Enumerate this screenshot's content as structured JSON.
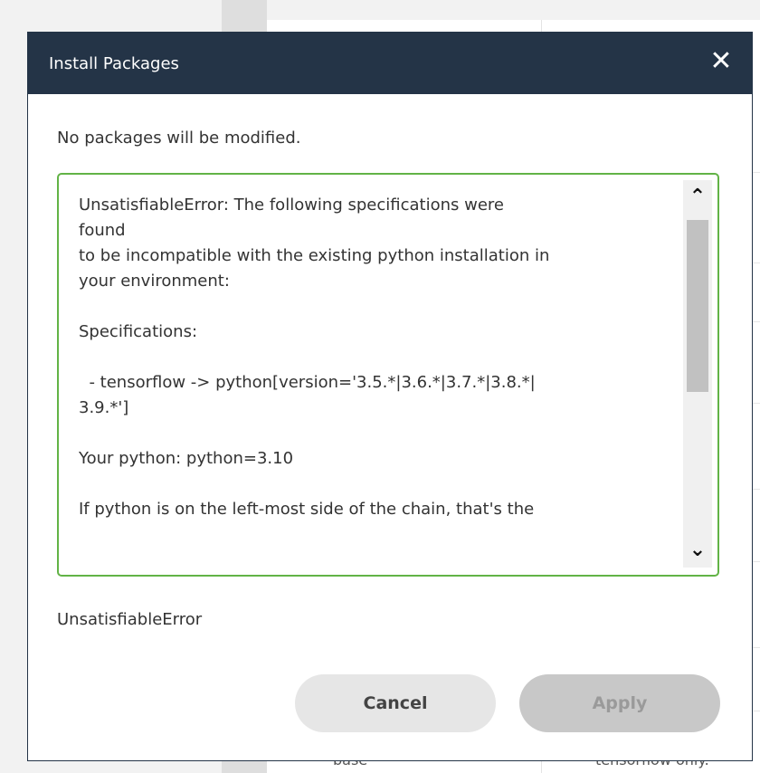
{
  "dialog": {
    "title": "Install Packages",
    "close_icon": "close-icon",
    "close_glyph": "✕",
    "summary": "No packages will be modified.",
    "error_lines": [
      "UnsatisfiableError: The following specifications were",
      "found",
      "to be incompatible with the existing python installation in",
      "your environment:",
      "",
      "Specifications:",
      "",
      "  - tensorflow -> python[version='3.5.*|3.6.*|3.7.*|3.8.*|",
      "3.9.*']",
      "",
      "Your python: python=3.10",
      "",
      "If python is on the left-most side of the chain, that's the"
    ],
    "error_label": "UnsatisfiableError",
    "cancel_label": "Cancel",
    "apply_label": "Apply",
    "scroll_up_glyph": "⌃",
    "scroll_down_glyph": "⌄"
  },
  "background": {
    "bottom_left_text": "base",
    "bottom_right_text": "tensorflow only."
  },
  "colors": {
    "header": "#243447",
    "error_border": "#62b346",
    "cancel_bg": "#e6e6e6",
    "apply_bg": "#c8c8c8"
  }
}
